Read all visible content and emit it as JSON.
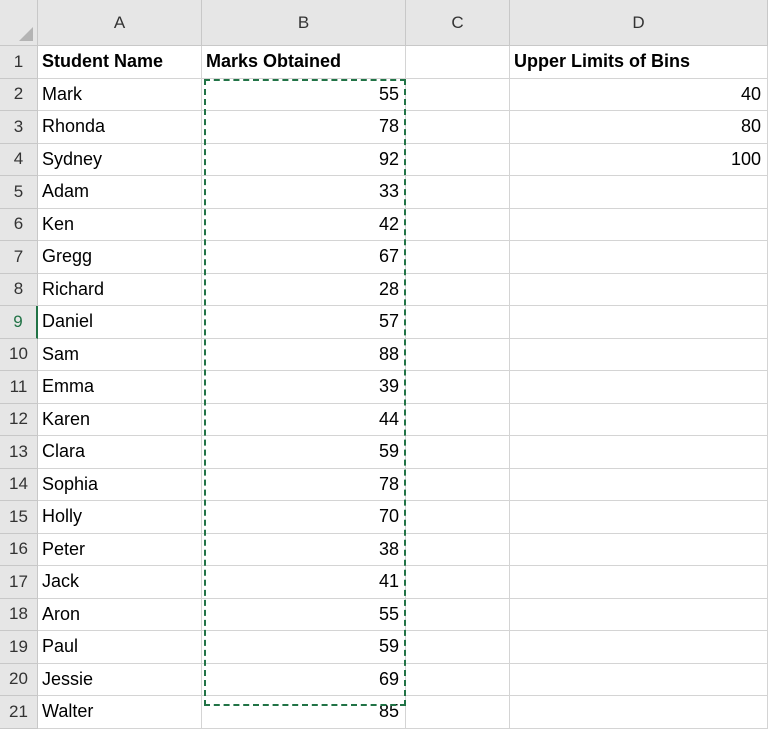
{
  "columns": [
    "A",
    "B",
    "C",
    "D"
  ],
  "rows": [
    {
      "n": "1",
      "a": "Student Name",
      "b": "Marks Obtained",
      "c": "",
      "d": "Upper Limits of Bins"
    },
    {
      "n": "2",
      "a": "Mark",
      "b": "55",
      "c": "",
      "d": "40"
    },
    {
      "n": "3",
      "a": "Rhonda",
      "b": "78",
      "c": "",
      "d": "80"
    },
    {
      "n": "4",
      "a": "Sydney",
      "b": "92",
      "c": "",
      "d": "100"
    },
    {
      "n": "5",
      "a": "Adam",
      "b": "33",
      "c": "",
      "d": ""
    },
    {
      "n": "6",
      "a": "Ken",
      "b": "42",
      "c": "",
      "d": ""
    },
    {
      "n": "7",
      "a": "Gregg",
      "b": "67",
      "c": "",
      "d": ""
    },
    {
      "n": "8",
      "a": "Richard",
      "b": "28",
      "c": "",
      "d": ""
    },
    {
      "n": "9",
      "a": "Daniel",
      "b": "57",
      "c": "",
      "d": ""
    },
    {
      "n": "10",
      "a": "Sam",
      "b": "88",
      "c": "",
      "d": ""
    },
    {
      "n": "11",
      "a": "Emma",
      "b": "39",
      "c": "",
      "d": ""
    },
    {
      "n": "12",
      "a": "Karen",
      "b": "44",
      "c": "",
      "d": ""
    },
    {
      "n": "13",
      "a": "Clara",
      "b": "59",
      "c": "",
      "d": ""
    },
    {
      "n": "14",
      "a": "Sophia",
      "b": "78",
      "c": "",
      "d": ""
    },
    {
      "n": "15",
      "a": "Holly",
      "b": "70",
      "c": "",
      "d": ""
    },
    {
      "n": "16",
      "a": "Peter",
      "b": "38",
      "c": "",
      "d": ""
    },
    {
      "n": "17",
      "a": "Jack",
      "b": "41",
      "c": "",
      "d": ""
    },
    {
      "n": "18",
      "a": "Aron",
      "b": "55",
      "c": "",
      "d": ""
    },
    {
      "n": "19",
      "a": "Paul",
      "b": "59",
      "c": "",
      "d": ""
    },
    {
      "n": "20",
      "a": "Jessie",
      "b": "69",
      "c": "",
      "d": ""
    },
    {
      "n": "21",
      "a": "Walter",
      "b": "85",
      "c": "",
      "d": ""
    }
  ],
  "selected_row": "9",
  "copy_range": "B2:B21",
  "colors": {
    "accent": "#217346",
    "header_bg": "#e6e6e6",
    "gridline": "#d4d4d4"
  }
}
